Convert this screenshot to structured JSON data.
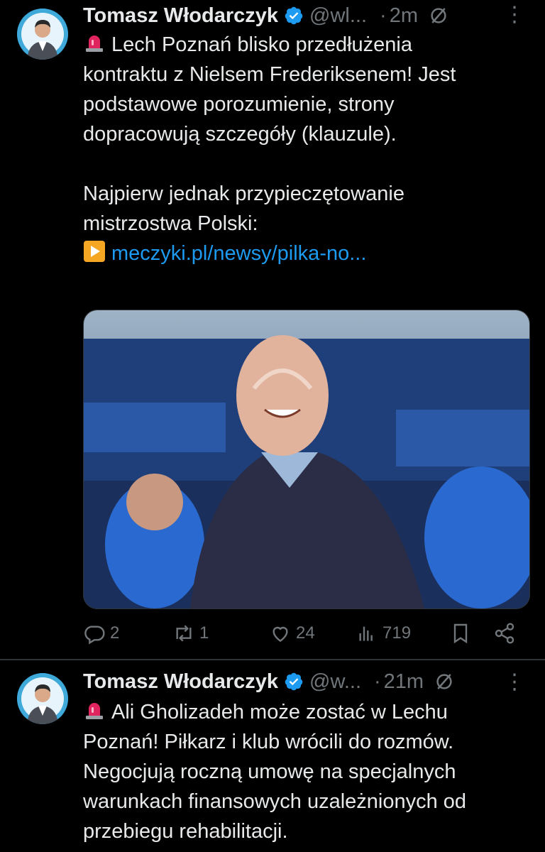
{
  "tweets": [
    {
      "author_name": "Tomasz Włodarczyk",
      "handle": "@wl...",
      "dot": "·",
      "time": "2m",
      "body_line1": "Lech Poznań blisko przedłużenia\nkontraktu z Nielsem Frederiksenem! Jest\npodstawowe porozumienie, strony\ndopracowują szczegóły (klauzule).\n\nNajpierw jednak przypieczętowanie\nmistrzostwa Polski:\n",
      "link": "meczyki.pl/newsy/pilka-no...",
      "stats": {
        "replies": "2",
        "reposts": "1",
        "likes": "24",
        "views": "719"
      }
    },
    {
      "author_name": "Tomasz Włodarczyk",
      "handle": "@w...",
      "dot": "·",
      "time": "21m",
      "body_line1": "Ali Gholizadeh może zostać w Lechu\nPoznań! Piłkarz i klub wrócili do rozmów.\nNegocjują roczną umowę na specjalnych\nwarunkach finansowych uzależnionych od\nprzebiegu rehabilitacji."
    }
  ],
  "colors": {
    "accent": "#1d9bf0",
    "muted": "#71767b",
    "text": "#e7e9ea",
    "background": "#000000"
  },
  "icons": [
    "avatar",
    "verified-badge-icon",
    "grok-icon",
    "more-icon",
    "police-light-emoji",
    "play-emoji",
    "reply-icon",
    "repost-icon",
    "like-icon",
    "views-icon",
    "bookmark-icon",
    "share-icon"
  ]
}
